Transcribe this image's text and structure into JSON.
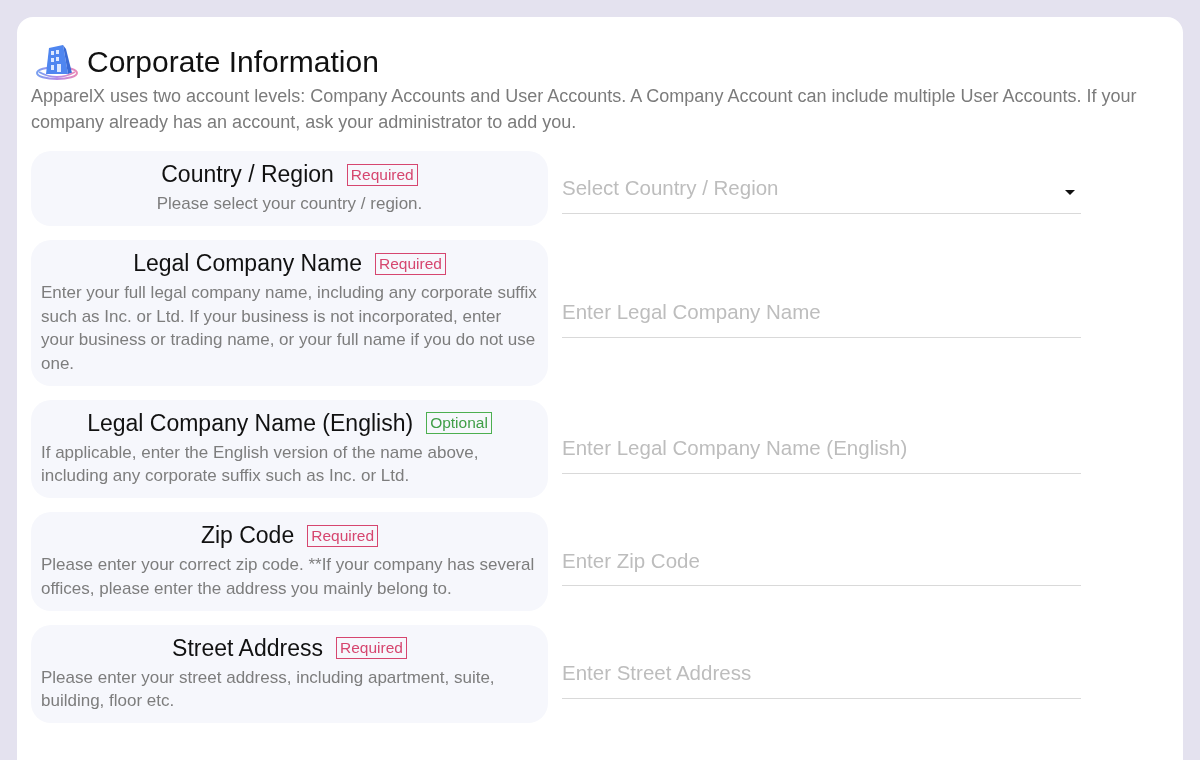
{
  "header": {
    "title": "Corporate Information",
    "description": "ApparelX uses two account levels: Company Accounts and User Accounts. A Company Account can include multiple User Accounts. If your company already has an account, ask your administrator to add you."
  },
  "fields": [
    {
      "label": "Country / Region",
      "badge": {
        "text": "Required",
        "kind": "required"
      },
      "help": "Please select your country / region.",
      "kind": "select",
      "placeholder": "Select Country / Region"
    },
    {
      "label": "Legal Company Name",
      "badge": {
        "text": "Required",
        "kind": "required"
      },
      "help": "Enter your full legal company name, including any corporate suffix such as Inc. or Ltd. If your business is not incorporated, enter your business or trading name, or your full name if you do not use one.",
      "kind": "text",
      "placeholder": "Enter Legal Company Name"
    },
    {
      "label": "Legal Company Name (English)",
      "badge": {
        "text": "Optional",
        "kind": "optional"
      },
      "help": "If applicable, enter the English version of the name above, including any corporate suffix such as Inc. or Ltd.",
      "kind": "text",
      "placeholder": "Enter Legal Company Name (English)"
    },
    {
      "label": "Zip Code",
      "badge": {
        "text": "Required",
        "kind": "required"
      },
      "help": "Please enter your correct zip code. **If your company has several offices, please enter the address you mainly belong to.",
      "kind": "text",
      "placeholder": "Enter Zip Code"
    },
    {
      "label": "Street Address",
      "badge": {
        "text": "Required",
        "kind": "required"
      },
      "help": "Please enter your street address, including apartment, suite, building, floor etc.",
      "kind": "text",
      "placeholder": "Enter Street Address"
    }
  ]
}
